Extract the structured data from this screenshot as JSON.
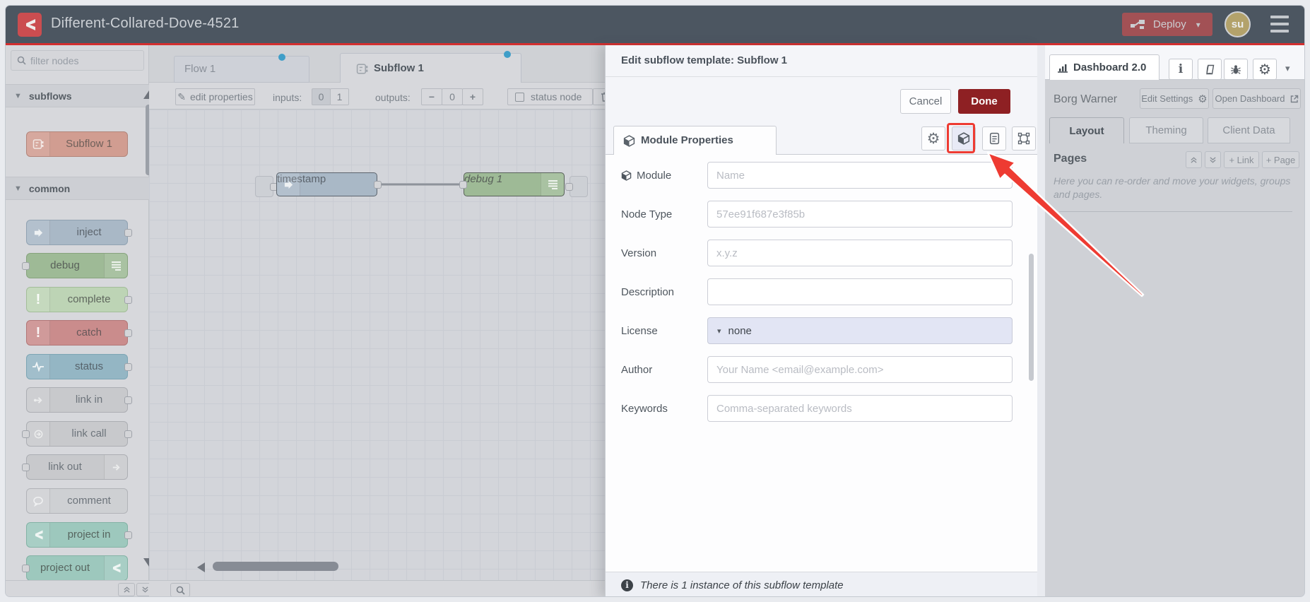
{
  "header": {
    "title": "Different-Collared-Dove-4521",
    "deploy_label": "Deploy",
    "avatar_initials": "su"
  },
  "palette": {
    "filter_placeholder": "filter nodes",
    "categories": [
      {
        "label": "subflows"
      },
      {
        "label": "common"
      }
    ],
    "subflow_nodes": [
      {
        "label": "Subflow 1"
      }
    ],
    "common_nodes": [
      {
        "label": "inject"
      },
      {
        "label": "debug"
      },
      {
        "label": "complete"
      },
      {
        "label": "catch"
      },
      {
        "label": "status"
      },
      {
        "label": "link in"
      },
      {
        "label": "link call"
      },
      {
        "label": "link out"
      },
      {
        "label": "comment"
      },
      {
        "label": "project in"
      },
      {
        "label": "project out"
      }
    ]
  },
  "workspace": {
    "tabs": [
      {
        "label": "Flow 1"
      },
      {
        "label": "Subflow 1"
      }
    ],
    "toolbar": {
      "edit_properties": "edit properties",
      "inputs_label": "inputs:",
      "input_zero": "0",
      "input_one": "1",
      "outputs_label": "outputs:",
      "minus": "−",
      "outputs_value": "0",
      "plus": "+",
      "status_node": "status node"
    },
    "nodes": [
      {
        "label": "timestamp"
      },
      {
        "label": "debug 1"
      }
    ]
  },
  "editor": {
    "title": "Edit subflow template: Subflow 1",
    "cancel_label": "Cancel",
    "done_label": "Done",
    "tab_label": "Module Properties",
    "fields": [
      {
        "label": "Module",
        "placeholder": "Name"
      },
      {
        "label": "Node Type",
        "placeholder": "57ee91f687e3f85b"
      },
      {
        "label": "Version",
        "placeholder": "x.y.z"
      },
      {
        "label": "Description",
        "placeholder": ""
      },
      {
        "label": "License",
        "value": "none"
      },
      {
        "label": "Author",
        "placeholder": "Your Name <email@example.com>"
      },
      {
        "label": "Keywords",
        "placeholder": "Comma-separated keywords"
      }
    ],
    "footer_note": "There is 1 instance of this subflow template"
  },
  "sidebar": {
    "dashboard_tab": "Dashboard 2.0",
    "project_name": "Borg Warner",
    "edit_settings_label": "Edit Settings",
    "open_dashboard_label": "Open Dashboard",
    "tabs": [
      {
        "label": "Layout"
      },
      {
        "label": "Theming"
      },
      {
        "label": "Client Data"
      }
    ],
    "pages_title": "Pages",
    "add_link_label": "+ Link",
    "add_page_label": "+ Page",
    "helper_text": "Here you can re-order and move your widgets, groups and pages."
  },
  "icons": {
    "caret_down": "▾",
    "pencil": "✎",
    "gear": "⚙",
    "info": "i"
  },
  "colors": {
    "accent_red": "#d32f2f",
    "done_button": "#8e2023",
    "annotation_red": "#ee3b32",
    "modified_dot": "#3f9ec8"
  }
}
